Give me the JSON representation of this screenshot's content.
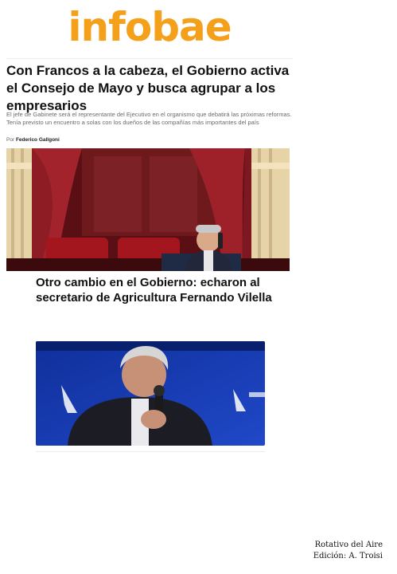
{
  "brand": {
    "logo_text": "infobae",
    "logo_color": "#f5a01a"
  },
  "main_article": {
    "headline": "Con Francos a la cabeza, el Gobierno activa el Consejo de Mayo y busca agrupar a los empresarios",
    "summary": "El jefe de Gabinete será el representante del Ejecutivo en el organismo que debatirá las próximas reformas. Tenía previsto un encuentro a solas con los dueños de las compañías más importantes del país",
    "byline_prefix": "Por",
    "author": "Federico Gallgoni"
  },
  "second_article": {
    "headline": "Otro cambio en el Gobierno: echaron al secretario de Agricultura Fernando Vilella"
  },
  "credits": {
    "line1": "Rotativo del Aire",
    "line2": "Edición: A. Troisi"
  },
  "colors": {
    "curtain": "#8e1c24",
    "stage_blue": "#1a3fb0"
  }
}
